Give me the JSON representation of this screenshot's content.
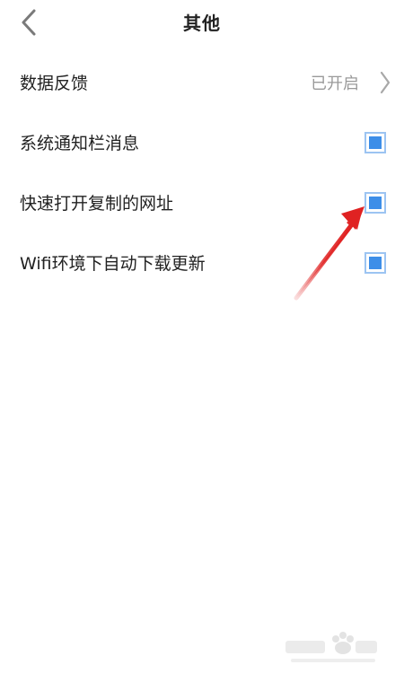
{
  "header": {
    "title": "其他",
    "back_icon": "chevron-left-icon"
  },
  "rows": [
    {
      "label": "数据反馈",
      "value": "已开启",
      "control": "chevron-right-icon"
    },
    {
      "label": "系统通知栏消息",
      "checked": true
    },
    {
      "label": "快速打开复制的网址",
      "checked": true
    },
    {
      "label": "Wifi环境下自动下载更新",
      "checked": true
    }
  ],
  "colors": {
    "accent": "#3d8ee8",
    "checkbox_border": "#9cc4f2",
    "annotation_arrow": "#e02222",
    "secondary_text": "#9a9a9a"
  }
}
